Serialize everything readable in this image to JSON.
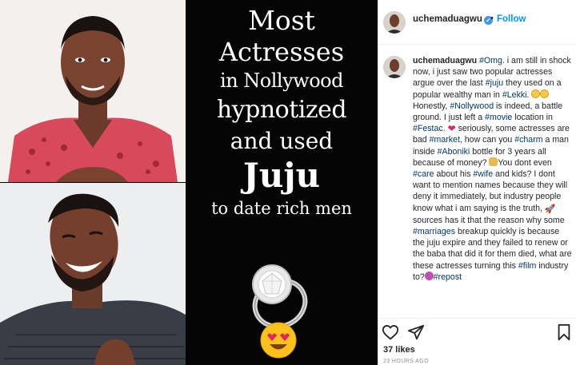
{
  "post": {
    "headline": {
      "line1": "Most",
      "line2": "Actresses",
      "line3": "in Nollywood",
      "line4": "hypnotized",
      "line5": "and used",
      "line6": "Juju",
      "line7": "to date rich men"
    }
  },
  "header": {
    "username": "uchemaduagwu",
    "verified_mark": "✓",
    "separator": "•",
    "follow_label": "Follow"
  },
  "caption": {
    "author": "uchemaduagwu",
    "tag_omg": "#Omg",
    "t1": ". i am still in shock now, i just saw two popular actresses argue over the last ",
    "tag_juju": "#juju",
    "t2": " they used on a popular wealthy man in ",
    "tag_lekki": "#Lekki",
    "t3": ". ",
    "t4": "Honestly, ",
    "tag_nollywood": "#Nollywood",
    "t5": " is indeed, a battle ground. I just left a ",
    "tag_movie": "#movie",
    "t6": " location in ",
    "tag_festac": "#Festac",
    "t7": ". ",
    "t8": " seriously, some actresses are bad ",
    "tag_market": "#market",
    "t9": ", how can you ",
    "tag_charm": "#charm",
    "t10": " a man inside ",
    "tag_aboniki": "#Aboniki",
    "t11": " bottle for 3 years all because of money? ",
    "t12": "You dont even ",
    "tag_care": "#care",
    "t13": " about his ",
    "tag_wife": "#wife",
    "t14": " and kids? I dont want to mention names because they will deny it immediately, but industry people know what i am saying is the truth, ",
    "t15": "sources has it that the reason why some ",
    "tag_marriages": "#marriages",
    "t16": " breakup quickly is because the juju expire and they failed to renew or the baba that did it for them died, what are these actresses turning this ",
    "tag_film": "#film",
    "t17": " industry to?",
    "tag_repost": "#repost",
    "emoji": {
      "smile": "smiling-face",
      "heart": "❤",
      "money": "money-bag",
      "rocket": "rocket",
      "person": "person-facepalming"
    }
  },
  "actions": {
    "like_icon": "heart-outline-icon",
    "share_icon": "paper-plane-icon",
    "save_icon": "bookmark-icon"
  },
  "stats": {
    "likes": "37 likes",
    "time": "23 HOURS AGO"
  },
  "colors": {
    "link": "#00376b",
    "follow": "#0095f6",
    "text": "#262626",
    "muted": "#8e8e8e",
    "panel": "#050505"
  }
}
